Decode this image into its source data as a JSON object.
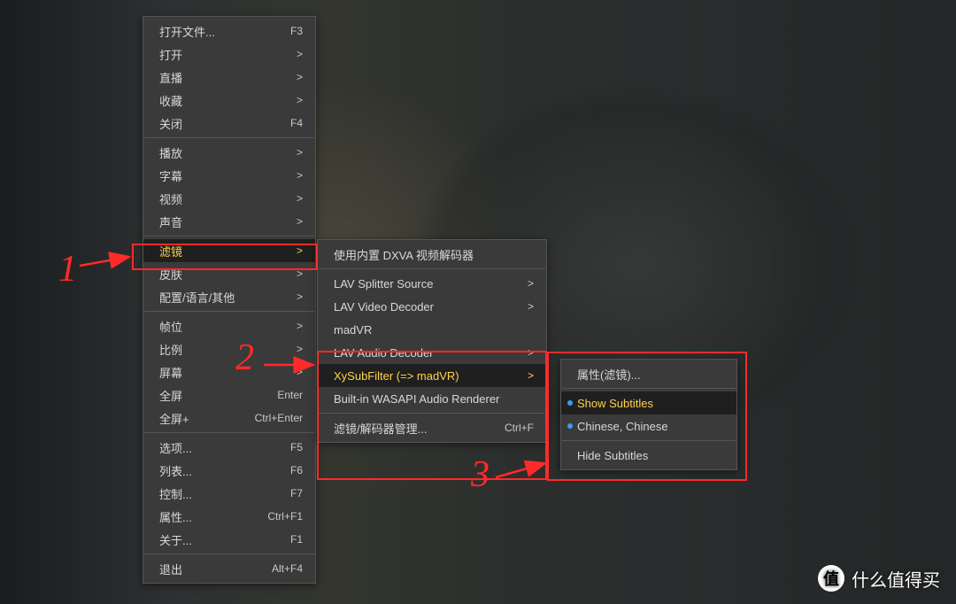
{
  "menu1": {
    "groups": [
      [
        {
          "label": "打开文件...",
          "hint": "F3",
          "name": "menu-open-file"
        },
        {
          "label": "打开",
          "arrow": ">",
          "name": "menu-open"
        },
        {
          "label": "直播",
          "arrow": ">",
          "name": "menu-live"
        },
        {
          "label": "收藏",
          "arrow": ">",
          "name": "menu-favorites"
        },
        {
          "label": "关闭",
          "hint": "F4",
          "name": "menu-close"
        }
      ],
      [
        {
          "label": "播放",
          "arrow": ">",
          "name": "menu-playback"
        },
        {
          "label": "字幕",
          "arrow": ">",
          "name": "menu-subtitles"
        },
        {
          "label": "视频",
          "arrow": ">",
          "name": "menu-video"
        },
        {
          "label": "声音",
          "arrow": ">",
          "name": "menu-audio"
        }
      ],
      [
        {
          "label": "滤镜",
          "arrow": ">",
          "name": "menu-filters",
          "hover": true
        },
        {
          "label": "皮肤",
          "arrow": ">",
          "name": "menu-skin"
        },
        {
          "label": "配置/语言/其他",
          "arrow": ">",
          "name": "menu-config-lang"
        }
      ],
      [
        {
          "label": "帧位",
          "arrow": ">",
          "name": "menu-frame"
        },
        {
          "label": "比例",
          "arrow": ">",
          "name": "menu-aspect"
        },
        {
          "label": "屏幕",
          "arrow": ">",
          "name": "menu-screen"
        },
        {
          "label": "全屏",
          "hint": "Enter",
          "name": "menu-fullscreen"
        },
        {
          "label": "全屏+",
          "hint": "Ctrl+Enter",
          "name": "menu-fullscreen-plus"
        }
      ],
      [
        {
          "label": "选项...",
          "hint": "F5",
          "name": "menu-options"
        },
        {
          "label": "列表...",
          "hint": "F6",
          "name": "menu-playlist"
        },
        {
          "label": "控制...",
          "hint": "F7",
          "name": "menu-control"
        },
        {
          "label": "属性...",
          "hint": "Ctrl+F1",
          "name": "menu-properties"
        },
        {
          "label": "关于...",
          "hint": "F1",
          "name": "menu-about"
        }
      ],
      [
        {
          "label": "退出",
          "hint": "Alt+F4",
          "name": "menu-exit"
        }
      ]
    ]
  },
  "menu2": {
    "groups": [
      [
        {
          "label": "使用内置 DXVA 视频解码器",
          "name": "menu-use-dxva"
        }
      ],
      [
        {
          "label": "LAV Splitter Source",
          "arrow": ">",
          "name": "menu-lav-splitter"
        },
        {
          "label": "LAV Video Decoder",
          "arrow": ">",
          "name": "menu-lav-video"
        },
        {
          "label": "madVR",
          "name": "menu-madvr"
        },
        {
          "label": "LAV Audio Decoder",
          "arrow": ">",
          "name": "menu-lav-audio"
        },
        {
          "label": "XySubFilter (=> madVR)",
          "arrow": ">",
          "name": "menu-xysubfilter",
          "hover": true
        },
        {
          "label": "Built-in WASAPI Audio Renderer",
          "arrow": ">",
          "name": "menu-wasapi"
        }
      ],
      [
        {
          "label": "滤镜/解码器管理...",
          "hint": "Ctrl+F",
          "name": "menu-filter-decoder-manage"
        }
      ]
    ]
  },
  "menu3": {
    "groups": [
      [
        {
          "label": "属性(滤镜)...",
          "name": "menu-filter-properties"
        }
      ],
      [
        {
          "label": "Show Subtitles",
          "name": "menu-show-subtitles",
          "dot": true,
          "hover": true
        },
        {
          "label": "Chinese, Chinese",
          "name": "menu-chinese",
          "dot": true
        }
      ],
      [
        {
          "label": "Hide Subtitles",
          "name": "menu-hide-subtitles"
        }
      ]
    ]
  },
  "annotations": {
    "n1": "1",
    "n2": "2",
    "n3": "3"
  },
  "watermark": {
    "badge": "值",
    "text": "什么值得买"
  }
}
